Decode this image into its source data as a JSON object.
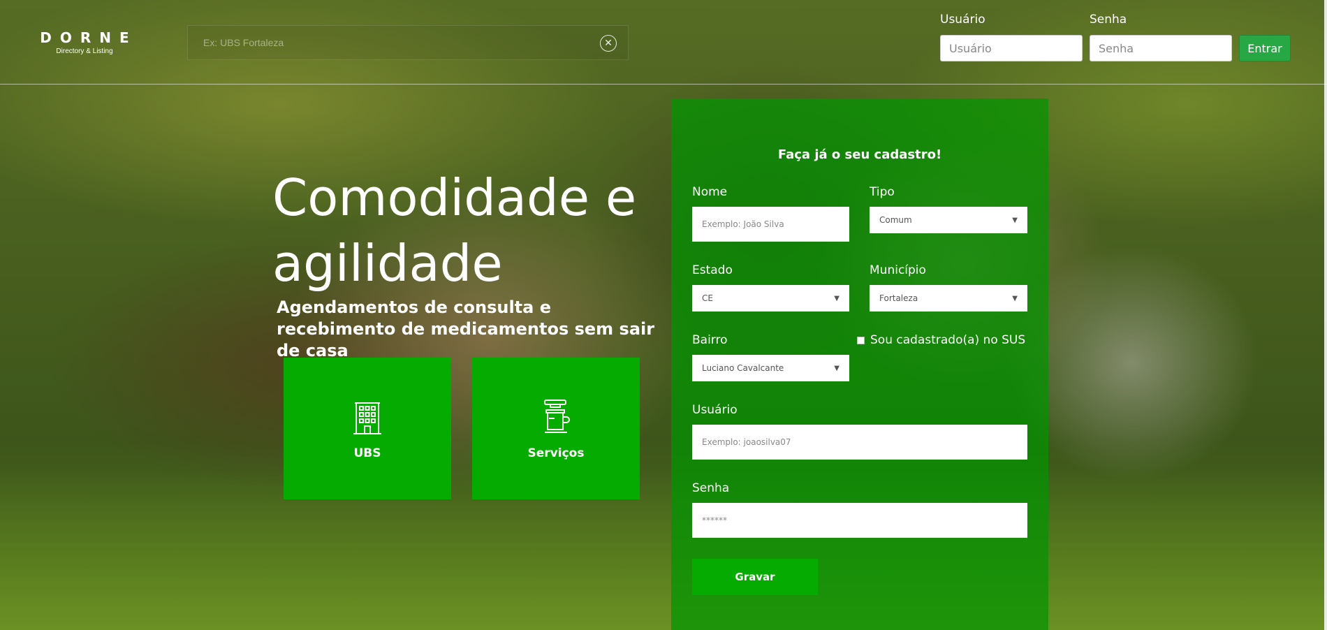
{
  "header": {
    "logo_title": "DORNE",
    "logo_subtitle": "Directory & Listing",
    "search_placeholder": "Ex: UBS Fortaleza",
    "username_label": "Usuário",
    "username_placeholder": "Usuário",
    "password_label": "Senha",
    "password_placeholder": "Senha",
    "login_button": "Entrar"
  },
  "hero": {
    "title": "Comodidade e agilidade",
    "subtitle": "Agendamentos de consulta e recebimento de medicamentos sem sair de casa",
    "tiles": [
      {
        "label": "UBS",
        "icon": "building-icon"
      },
      {
        "label": "Serviços",
        "icon": "coffee-cup-icon"
      }
    ]
  },
  "form": {
    "title": "Faça já o seu cadastro!",
    "name_label": "Nome",
    "name_placeholder": "Exemplo: João Silva",
    "type_label": "Tipo",
    "type_value": "Comum",
    "state_label": "Estado",
    "state_value": "CE",
    "city_label": "Município",
    "city_value": "Fortaleza",
    "district_label": "Bairro",
    "district_value": "Luciano Cavalcante",
    "sus_label": "Sou cadastrado(a) no SUS",
    "user_label": "Usuário",
    "user_placeholder": "Exemplo: joaosilva07",
    "password_label": "Senha",
    "password_placeholder": "******",
    "save_button": "Gravar"
  },
  "colors": {
    "tile_green": "#06ab00",
    "panel_green": "#009600",
    "login_green": "#28a745"
  }
}
